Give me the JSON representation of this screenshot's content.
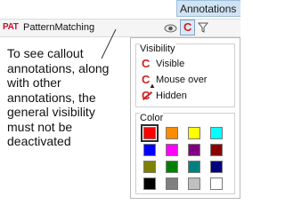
{
  "ribbon": {
    "tab_label": "Annotations"
  },
  "layer": {
    "type_badge": "PAT",
    "name": "PatternMatching",
    "callout_button_glyph": "C",
    "icons": [
      "eye-icon",
      "callout-icon",
      "filter-icon"
    ]
  },
  "callout": {
    "lines": [
      "To see callout",
      "annotations, along",
      "with other",
      "annotations, the",
      "general visibility",
      "must not be",
      "deactivated"
    ]
  },
  "popup": {
    "visibility": {
      "title": "Visibility",
      "options": [
        {
          "label": "Visible",
          "icon": "callout-icon"
        },
        {
          "label": "Mouse over",
          "icon": "callout-mouseover-icon"
        },
        {
          "label": "Hidden",
          "icon": "callout-hidden-icon"
        }
      ]
    },
    "color": {
      "title": "Color",
      "selected_index": 0,
      "swatches": [
        "#ff0000",
        "#ff8c00",
        "#ffff00",
        "#00ffff",
        "#0000ff",
        "#ff00ff",
        "#800080",
        "#8b0000",
        "#808000",
        "#008000",
        "#008080",
        "#000080",
        "#000000",
        "#808080",
        "#c0c0c0",
        "#ffffff"
      ]
    }
  },
  "colors": {
    "accent_red": "#d21f1f",
    "tab_bg": "#cfe3f3"
  }
}
